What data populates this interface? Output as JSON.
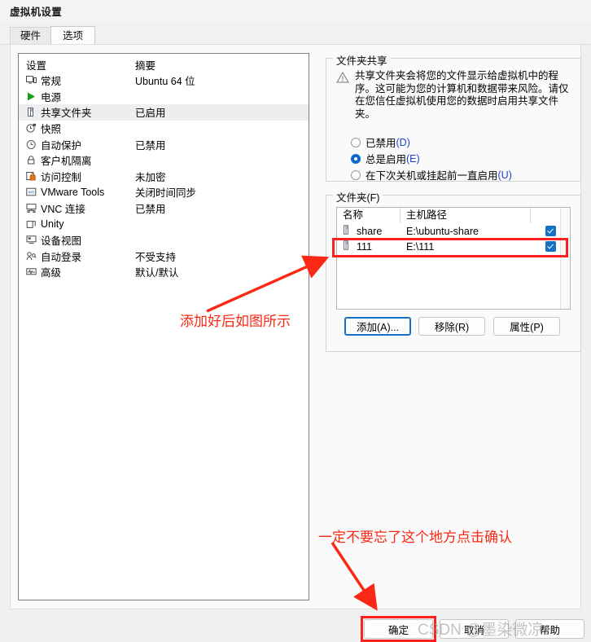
{
  "window": {
    "title": "虚拟机设置"
  },
  "tabs": [
    {
      "label": "硬件",
      "selected": false
    },
    {
      "label": "选项",
      "selected": true
    }
  ],
  "settings_list": {
    "headers": {
      "name": "设置",
      "summary": "摘要"
    },
    "rows": [
      {
        "icon": "monitor-icon",
        "label": "常规",
        "summary": "Ubuntu 64 位",
        "selected": false
      },
      {
        "icon": "power-play-icon",
        "label": "电源",
        "summary": "",
        "selected": false
      },
      {
        "icon": "shared-folder-icon",
        "label": "共享文件夹",
        "summary": "已启用",
        "selected": true
      },
      {
        "icon": "camera-clock-icon",
        "label": "快照",
        "summary": "",
        "selected": false
      },
      {
        "icon": "clock-icon",
        "label": "自动保护",
        "summary": "已禁用",
        "selected": false
      },
      {
        "icon": "lock-icon",
        "label": "客户机隔离",
        "summary": "",
        "selected": false
      },
      {
        "icon": "access-lock-icon",
        "label": "访问控制",
        "summary": "未加密",
        "selected": false
      },
      {
        "icon": "vmware-tools-icon",
        "label": "VMware Tools",
        "summary": "关闭时间同步",
        "selected": false
      },
      {
        "icon": "vnc-icon",
        "label": "VNC 连接",
        "summary": "已禁用",
        "selected": false
      },
      {
        "icon": "unity-window-icon",
        "label": "Unity",
        "summary": "",
        "selected": false
      },
      {
        "icon": "device-view-icon",
        "label": "设备视图",
        "summary": "",
        "selected": false
      },
      {
        "icon": "auto-login-icon",
        "label": "自动登录",
        "summary": "不受支持",
        "selected": false
      },
      {
        "icon": "advanced-icon",
        "label": "高级",
        "summary": "默认/默认",
        "selected": false
      }
    ]
  },
  "folder_sharing": {
    "group_title": "文件夹共享",
    "warning_text": "共享文件夹会将您的文件显示给虚拟机中的程序。这可能为您的计算机和数据带来风险。请仅在您信任虚拟机使用您的数据时启用共享文件夹。",
    "options": [
      {
        "label": "已禁用",
        "mnemonic": "(D)",
        "checked": false
      },
      {
        "label": "总是启用",
        "mnemonic": "(E)",
        "checked": true
      },
      {
        "label": "在下次关机或挂起前一直启用",
        "mnemonic": "(U)",
        "checked": false
      }
    ]
  },
  "folders": {
    "group_title": "文件夹(F)",
    "headers": {
      "name": "名称",
      "path": "主机路径",
      "enabled": ""
    },
    "rows": [
      {
        "name": "share",
        "path": "E:\\ubuntu-share",
        "enabled": true,
        "highlighted": false
      },
      {
        "name": "111",
        "path": "E:\\111",
        "enabled": true,
        "highlighted": true
      }
    ],
    "buttons": [
      {
        "label": "添加(A)...",
        "focused": true
      },
      {
        "label": "移除(R)",
        "focused": false
      },
      {
        "label": "属性(P)",
        "focused": false
      }
    ]
  },
  "footer_buttons": [
    {
      "label": "确定",
      "highlighted": true
    },
    {
      "label": "取消",
      "highlighted": false
    },
    {
      "label": "帮助",
      "highlighted": false
    }
  ],
  "annotations": [
    {
      "text": "添加好后如图所示"
    },
    {
      "text": "一定不要忘了这个地方点击确认"
    }
  ],
  "watermark": {
    "text": "CSDN @墨染微凉 ~"
  },
  "colors": {
    "accent_blue": "#1471c4",
    "annotation_red": "#fa2814",
    "selected_row": "#eeeeee"
  }
}
